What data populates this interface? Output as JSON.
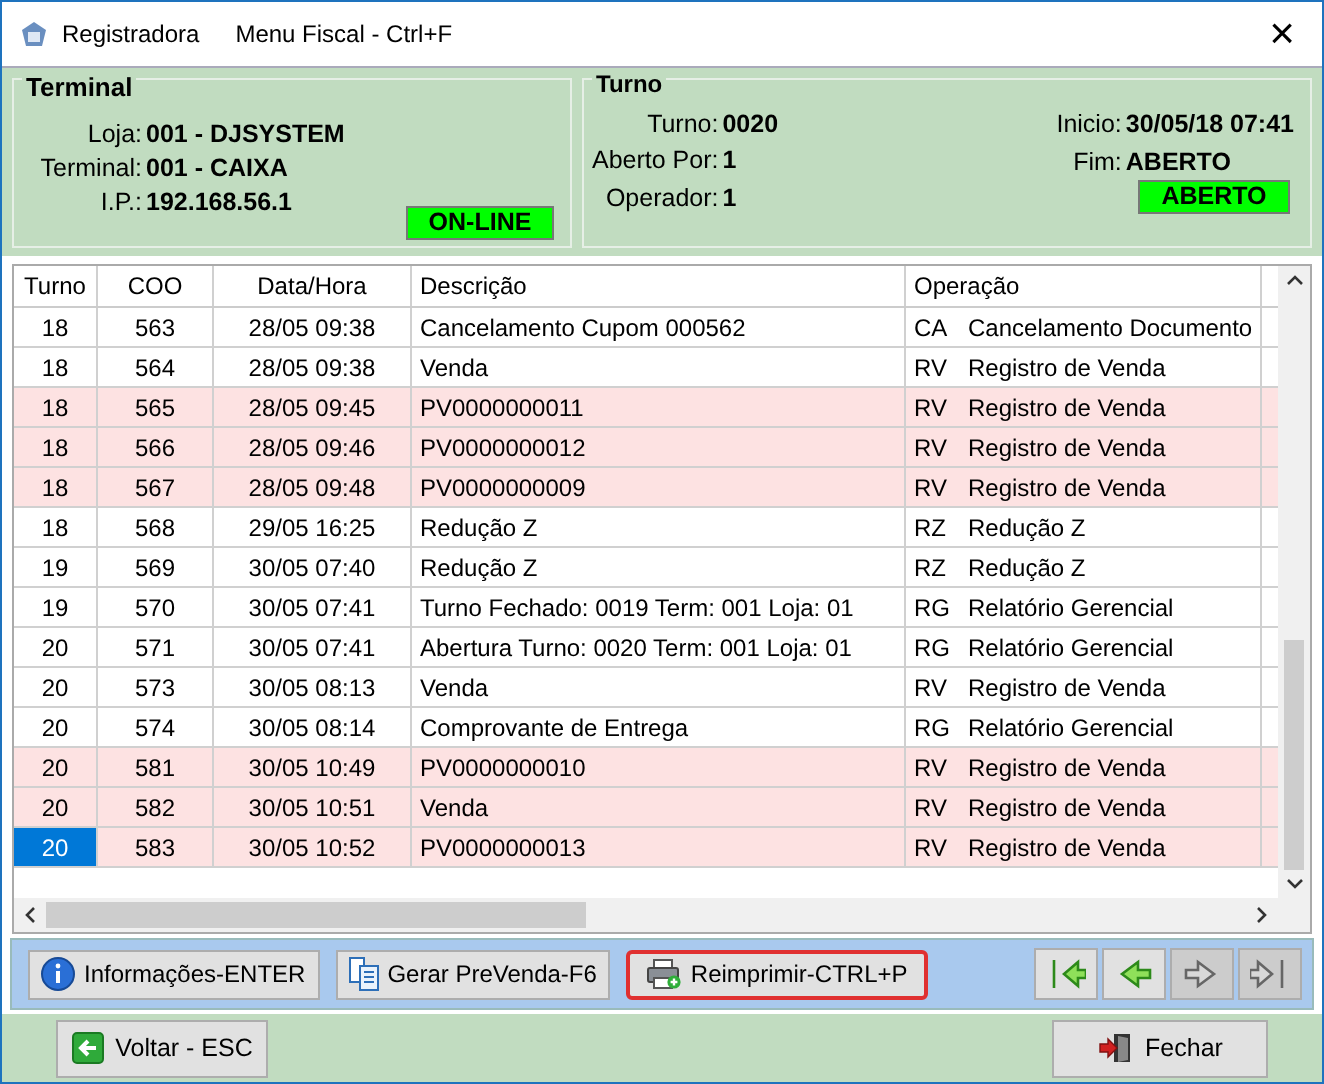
{
  "window": {
    "title": "Registradora",
    "menu": "Menu Fiscal - Ctrl+F",
    "close": "×"
  },
  "terminal": {
    "title": "Terminal",
    "fields": [
      {
        "label": "Loja:",
        "value": "001 - DJSYSTEM"
      },
      {
        "label": "Terminal:",
        "value": "001 - CAIXA"
      },
      {
        "label": "I.P.:",
        "value": "192.168.56.1"
      }
    ],
    "status": "ON-LINE"
  },
  "turno": {
    "title": "Turno",
    "fields": [
      {
        "label": "Turno:",
        "value": "0020"
      },
      {
        "label": "Aberto Por:",
        "value": "1"
      },
      {
        "label": "Operador:",
        "value": "1"
      }
    ],
    "right_fields": [
      {
        "label": "Inicio:",
        "value": "30/05/18 07:41"
      },
      {
        "label": "Fim:",
        "value": "ABERTO"
      }
    ],
    "status": "ABERTO"
  },
  "table": {
    "columns": [
      "Turno",
      "COO",
      "Data/Hora",
      "Descrição",
      "Operação"
    ],
    "rows": [
      {
        "turno": "18",
        "coo": "563",
        "data_hora": "28/05 09:38",
        "descricao": "Cancelamento Cupom 000562",
        "op_code": "CA",
        "operacao": "Cancelamento Documento",
        "highlighted": false,
        "selected": false
      },
      {
        "turno": "18",
        "coo": "564",
        "data_hora": "28/05 09:38",
        "descricao": "Venda",
        "op_code": "RV",
        "operacao": "Registro de Venda",
        "highlighted": false,
        "selected": false
      },
      {
        "turno": "18",
        "coo": "565",
        "data_hora": "28/05 09:45",
        "descricao": "PV0000000011",
        "op_code": "RV",
        "operacao": "Registro de Venda",
        "highlighted": true,
        "selected": false
      },
      {
        "turno": "18",
        "coo": "566",
        "data_hora": "28/05 09:46",
        "descricao": "PV0000000012",
        "op_code": "RV",
        "operacao": "Registro de Venda",
        "highlighted": true,
        "selected": false
      },
      {
        "turno": "18",
        "coo": "567",
        "data_hora": "28/05 09:48",
        "descricao": "PV0000000009",
        "op_code": "RV",
        "operacao": "Registro de Venda",
        "highlighted": true,
        "selected": false
      },
      {
        "turno": "18",
        "coo": "568",
        "data_hora": "29/05 16:25",
        "descricao": "Redução Z",
        "op_code": "RZ",
        "operacao": "Redução Z",
        "highlighted": false,
        "selected": false
      },
      {
        "turno": "19",
        "coo": "569",
        "data_hora": "30/05 07:40",
        "descricao": "Redução Z",
        "op_code": "RZ",
        "operacao": "Redução Z",
        "highlighted": false,
        "selected": false
      },
      {
        "turno": "19",
        "coo": "570",
        "data_hora": "30/05 07:41",
        "descricao": "Turno Fechado: 0019 Term: 001 Loja: 01",
        "op_code": "RG",
        "operacao": "Relatório Gerencial",
        "highlighted": false,
        "selected": false
      },
      {
        "turno": "20",
        "coo": "571",
        "data_hora": "30/05 07:41",
        "descricao": "Abertura Turno: 0020 Term: 001 Loja: 01",
        "op_code": "RG",
        "operacao": "Relatório Gerencial",
        "highlighted": false,
        "selected": false
      },
      {
        "turno": "20",
        "coo": "573",
        "data_hora": "30/05 08:13",
        "descricao": "Venda",
        "op_code": "RV",
        "operacao": "Registro de Venda",
        "highlighted": false,
        "selected": false
      },
      {
        "turno": "20",
        "coo": "574",
        "data_hora": "30/05 08:14",
        "descricao": "Comprovante de Entrega",
        "op_code": "RG",
        "operacao": "Relatório Gerencial",
        "highlighted": false,
        "selected": false
      },
      {
        "turno": "20",
        "coo": "581",
        "data_hora": "30/05 10:49",
        "descricao": "PV0000000010",
        "op_code": "RV",
        "operacao": "Registro de Venda",
        "highlighted": true,
        "selected": false
      },
      {
        "turno": "20",
        "coo": "582",
        "data_hora": "30/05 10:51",
        "descricao": "Venda",
        "op_code": "RV",
        "operacao": "Registro de Venda",
        "highlighted": true,
        "selected": false
      },
      {
        "turno": "20",
        "coo": "583",
        "data_hora": "30/05 10:52",
        "descricao": "PV0000000013",
        "op_code": "RV",
        "operacao": "Registro de Venda",
        "highlighted": true,
        "selected": true
      }
    ]
  },
  "toolbar": {
    "buttons": [
      {
        "kind": "info",
        "label": "Informações-ENTER",
        "focused": false
      },
      {
        "kind": "document",
        "label": "Gerar PreVenda-F6",
        "focused": false
      },
      {
        "kind": "printer",
        "label": "Reimprimir-CTRL+P",
        "focused": true
      }
    ],
    "nav": [
      {
        "kind": "first",
        "disabled": false
      },
      {
        "kind": "previous",
        "disabled": false
      },
      {
        "kind": "next",
        "disabled": true
      },
      {
        "kind": "last",
        "disabled": true
      }
    ]
  },
  "footer": {
    "back": "Voltar - ESC",
    "close": "Fechar"
  }
}
